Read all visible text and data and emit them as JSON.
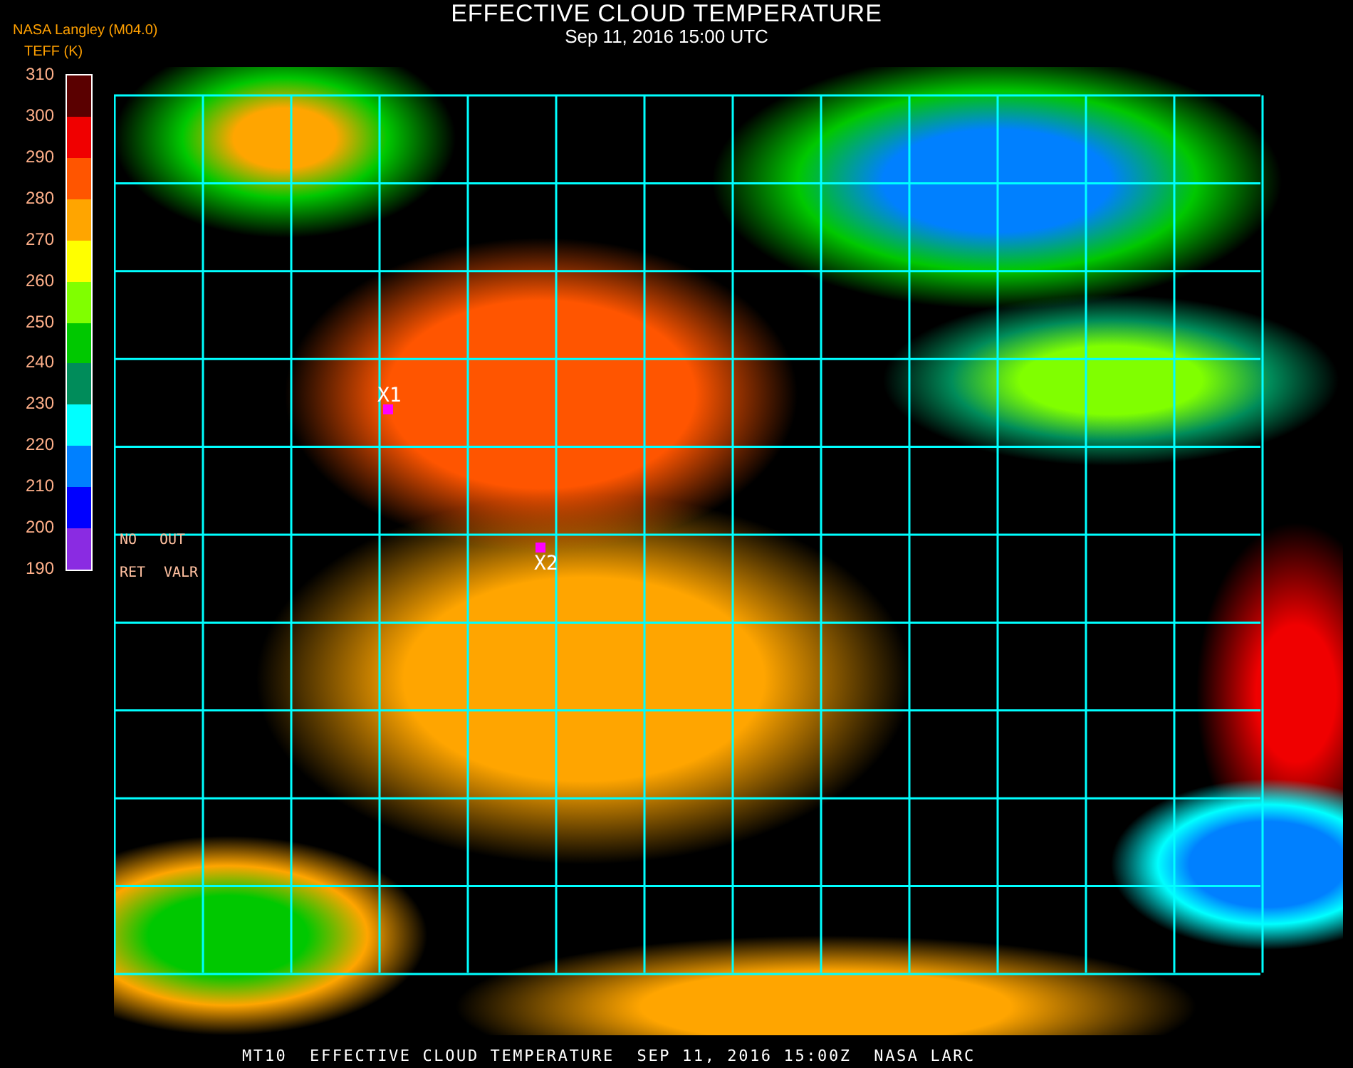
{
  "title": "EFFECTIVE CLOUD TEMPERATURE",
  "subtitle": "Sep 11, 2016 15:00 UTC",
  "legend": {
    "source": "NASA Langley (M04.0)",
    "unit": "TEFF (K)",
    "segments": [
      {
        "color": "#5a0000"
      },
      {
        "color": "#f00000"
      },
      {
        "color": "#ff5500"
      },
      {
        "color": "#ffa500"
      },
      {
        "color": "#ffff00"
      },
      {
        "color": "#80ff00"
      },
      {
        "color": "#00c800"
      },
      {
        "color": "#008c5a"
      },
      {
        "color": "#00ffff"
      },
      {
        "color": "#0080ff"
      },
      {
        "color": "#0000ff"
      },
      {
        "color": "#8a2be2"
      }
    ],
    "ticks": [
      "310",
      "300",
      "290",
      "280",
      "270",
      "260",
      "250",
      "240",
      "230",
      "220",
      "210",
      "200",
      "190"
    ]
  },
  "map": {
    "no_data_codes": [
      "NO",
      "OUT",
      "RET",
      "VALR"
    ],
    "markers": [
      {
        "label": "X1"
      },
      {
        "label": "X2"
      }
    ]
  },
  "footer": "MT10  EFFECTIVE CLOUD TEMPERATURE  SEP 11, 2016 15:00Z  NASA LARC"
}
